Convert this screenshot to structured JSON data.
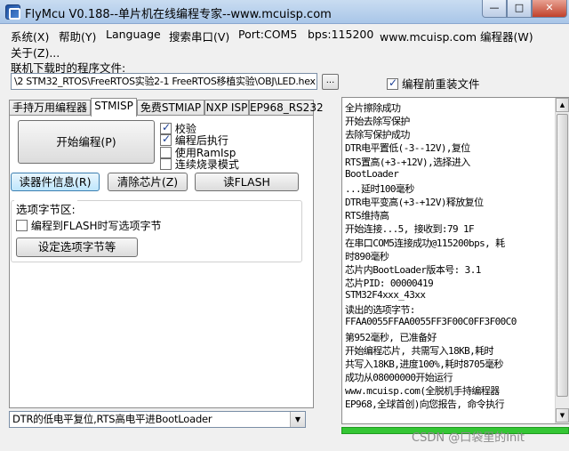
{
  "window": {
    "title": "FlyMcu V0.188--单片机在线编程专家--www.mcuisp.com",
    "min": "—",
    "max": "□",
    "close": "✕"
  },
  "menu": {
    "items": [
      "系统(X)",
      "帮助(Y)",
      "Language",
      "搜索串口(V)",
      "Port:COM5",
      "bps:115200",
      "www.mcuisp.com 编程器(W)",
      "关于(Z)..."
    ]
  },
  "file": {
    "label": "联机下载时的程序文件:",
    "path": "\\2 STM32_RTOS\\FreeRTOS实验2-1 FreeRTOS移植实验\\OBJ\\LED.hex",
    "browse": "...",
    "reload_label": "编程前重装文件",
    "reload_checked": true
  },
  "tabs": [
    "手持万用编程器",
    "STMISP",
    "免费STMIAP",
    "NXP ISP",
    "EP968_RS232"
  ],
  "stmisp": {
    "start_button": "开始编程(P)",
    "checkboxes": [
      {
        "label": "校验",
        "checked": true
      },
      {
        "label": "编程后执行",
        "checked": true
      },
      {
        "label": "使用RamIsp",
        "checked": false
      },
      {
        "label": "连续烧录模式",
        "checked": false
      }
    ],
    "read_info_button": "读器件信息(R)",
    "erase_button": "清除芯片(Z)",
    "read_flash_button": "读FLASH",
    "option_group": {
      "legend": "选项字节区:",
      "write_checkbox": "编程到FLASH时写选项字节",
      "set_button": "设定选项字节等"
    }
  },
  "boot_mode": "DTR的低电平复位,RTS高电平进BootLoader",
  "log": [
    "全片擦除成功",
    "开始去除写保护",
    "去除写保护成功",
    "DTR电平置低(-3--12V),复位",
    "RTS置高(+3-+12V),选择进入",
    "BootLoader",
    "...延时100毫秒",
    "DTR电平变高(+3-+12V)释放复位",
    "RTS维持高",
    "开始连接...5, 接收到:79 1F",
    "在串口COM5连接成功@115200bps, 耗",
    "时890毫秒",
    "芯片内BootLoader版本号: 3.1",
    "芯片PID: 00000419",
    "STM32F4xxx_43xx",
    "读出的选项字节:",
    "FFAA0055FFAA0055FF3F00C0FF3F00C0",
    "第952毫秒, 已准备好",
    "开始编程芯片, 共需写入18KB,耗时",
    "共写入18KB,进度100%,耗时8705毫秒",
    "成功从08000000开始运行",
    "www.mcuisp.com(全脱机手持编程器",
    "EP968,全球首创)向您报告, 命令执行"
  ],
  "progress_fraction": 1.0,
  "watermark": "CSDN @口袋里的Init",
  "colors": {
    "titlebar": "#a9c6e8",
    "progress": "#34c634",
    "close_button": "#c0412b"
  }
}
